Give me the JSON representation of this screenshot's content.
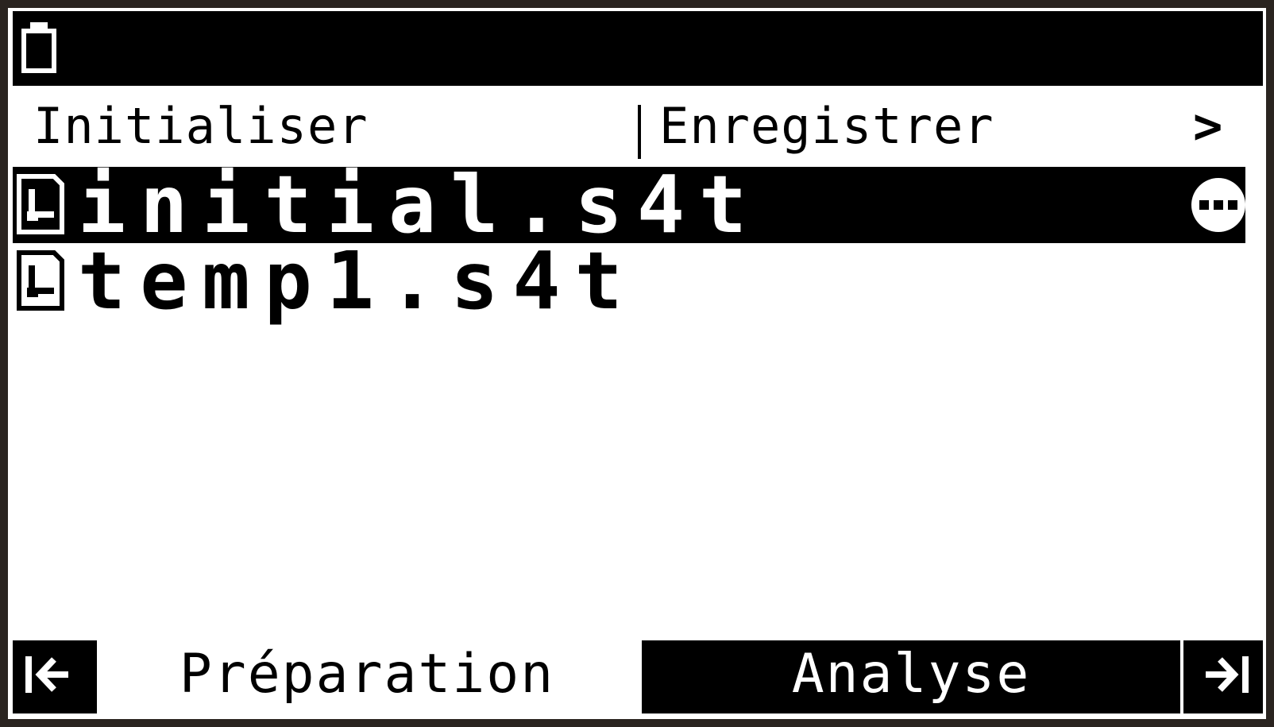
{
  "status_bar": {
    "battery_icon": "battery-icon"
  },
  "menu": {
    "left_label": "Initialiser",
    "right_label": "Enregistrer",
    "more_label": ">"
  },
  "files": [
    {
      "name": "initial.s4t",
      "selected": true,
      "icon": "file-icon",
      "options_icon": "more-options-icon"
    },
    {
      "name": "temp1.s4t",
      "selected": false,
      "icon": "file-icon"
    }
  ],
  "tabs": {
    "preparation": "Préparation",
    "analyse": "Analyse",
    "active": "preparation"
  },
  "nav": {
    "first_icon": "arrow-left-to-bar-icon",
    "last_icon": "arrow-right-to-bar-icon"
  },
  "colors": {
    "foreground": "#000000",
    "background": "#ffffff",
    "frame": "#2a2420"
  }
}
